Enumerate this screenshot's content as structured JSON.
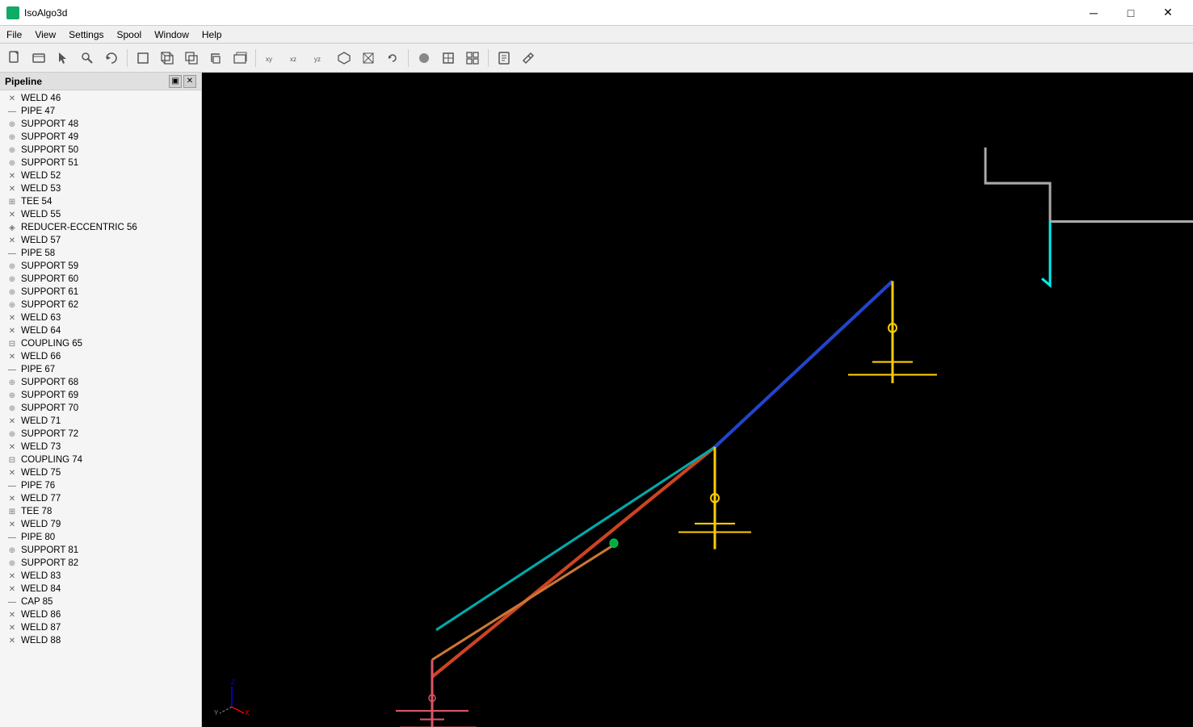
{
  "app": {
    "title": "IsoAlgo3d",
    "icon": "3d-app-icon"
  },
  "titlebar": {
    "minimize_label": "─",
    "maximize_label": "□",
    "close_label": "✕"
  },
  "menubar": {
    "items": [
      {
        "label": "File"
      },
      {
        "label": "View"
      },
      {
        "label": "Settings"
      },
      {
        "label": "Spool"
      },
      {
        "label": "Window"
      },
      {
        "label": "Help"
      }
    ]
  },
  "toolbar": {
    "buttons": [
      {
        "name": "new",
        "icon": "📄"
      },
      {
        "name": "open",
        "icon": "📂"
      },
      {
        "name": "pointer",
        "icon": "↖"
      },
      {
        "name": "search",
        "icon": "🔍"
      },
      {
        "name": "refresh",
        "icon": "↺"
      },
      {
        "name": "copy1",
        "icon": "⬜"
      },
      {
        "name": "copy2",
        "icon": "⬜"
      },
      {
        "name": "copy3",
        "icon": "⬜"
      },
      {
        "name": "copy4",
        "icon": "⬜"
      },
      {
        "name": "copy5",
        "icon": "⬜"
      },
      {
        "name": "box1",
        "icon": "⬛"
      },
      {
        "name": "view1",
        "icon": "◱"
      },
      {
        "name": "view2",
        "icon": "◳"
      },
      {
        "name": "view3",
        "icon": "◰"
      },
      {
        "name": "fit",
        "icon": "⊡"
      },
      {
        "name": "reset",
        "icon": "↩"
      },
      {
        "name": "sphere",
        "icon": "●"
      },
      {
        "name": "select",
        "icon": "▣"
      },
      {
        "name": "group",
        "icon": "⊞"
      },
      {
        "name": "sep1",
        "icon": ""
      },
      {
        "name": "book",
        "icon": "📖"
      },
      {
        "name": "tool2",
        "icon": "✈"
      }
    ]
  },
  "pipeline": {
    "title": "Pipeline",
    "items": [
      {
        "id": 46,
        "type": "WELD",
        "label": "WELD 46"
      },
      {
        "id": 47,
        "type": "PIPE",
        "label": "PIPE 47"
      },
      {
        "id": 48,
        "type": "SUPPORT",
        "label": "SUPPORT 48"
      },
      {
        "id": 49,
        "type": "SUPPORT",
        "label": "SUPPORT 49"
      },
      {
        "id": 50,
        "type": "SUPPORT",
        "label": "SUPPORT 50"
      },
      {
        "id": 51,
        "type": "SUPPORT",
        "label": "SUPPORT 51"
      },
      {
        "id": 52,
        "type": "WELD",
        "label": "WELD 52"
      },
      {
        "id": 53,
        "type": "WELD",
        "label": "WELD 53"
      },
      {
        "id": 54,
        "type": "TEE",
        "label": "TEE 54"
      },
      {
        "id": 55,
        "type": "WELD",
        "label": "WELD 55"
      },
      {
        "id": 56,
        "type": "REDUCER-ECCENTRIC",
        "label": "REDUCER-ECCENTRIC 56"
      },
      {
        "id": 57,
        "type": "WELD",
        "label": "WELD 57"
      },
      {
        "id": 58,
        "type": "PIPE",
        "label": "PIPE 58"
      },
      {
        "id": 59,
        "type": "SUPPORT",
        "label": "SUPPORT 59"
      },
      {
        "id": 60,
        "type": "SUPPORT",
        "label": "SUPPORT 60"
      },
      {
        "id": 61,
        "type": "SUPPORT",
        "label": "SUPPORT 61"
      },
      {
        "id": 62,
        "type": "SUPPORT",
        "label": "SUPPORT 62"
      },
      {
        "id": 63,
        "type": "WELD",
        "label": "WELD 63"
      },
      {
        "id": 64,
        "type": "WELD",
        "label": "WELD 64"
      },
      {
        "id": 65,
        "type": "COUPLING",
        "label": "COUPLING 65"
      },
      {
        "id": 66,
        "type": "WELD",
        "label": "WELD 66"
      },
      {
        "id": 67,
        "type": "PIPE",
        "label": "PIPE 67"
      },
      {
        "id": 68,
        "type": "SUPPORT",
        "label": "SUPPORT 68"
      },
      {
        "id": 69,
        "type": "SUPPORT",
        "label": "SUPPORT 69"
      },
      {
        "id": 70,
        "type": "SUPPORT",
        "label": "SUPPORT 70"
      },
      {
        "id": 71,
        "type": "WELD",
        "label": "WELD 71"
      },
      {
        "id": 72,
        "type": "SUPPORT",
        "label": "SUPPORT 72"
      },
      {
        "id": 73,
        "type": "WELD",
        "label": "WELD 73"
      },
      {
        "id": 74,
        "type": "COUPLING",
        "label": "COUPLING 74"
      },
      {
        "id": 75,
        "type": "WELD",
        "label": "WELD 75"
      },
      {
        "id": 76,
        "type": "PIPE",
        "label": "PIPE 76"
      },
      {
        "id": 77,
        "type": "WELD",
        "label": "WELD 77"
      },
      {
        "id": 78,
        "type": "TEE",
        "label": "TEE 78"
      },
      {
        "id": 79,
        "type": "WELD",
        "label": "WELD 79"
      },
      {
        "id": 80,
        "type": "PIPE",
        "label": "PIPE 80"
      },
      {
        "id": 81,
        "type": "SUPPORT",
        "label": "SUPPORT 81"
      },
      {
        "id": 82,
        "type": "SUPPORT",
        "label": "SUPPORT 82"
      },
      {
        "id": 83,
        "type": "WELD",
        "label": "WELD 83"
      },
      {
        "id": 84,
        "type": "WELD",
        "label": "WELD 84"
      },
      {
        "id": 85,
        "type": "CAP",
        "label": "CAP 85"
      },
      {
        "id": 86,
        "type": "WELD",
        "label": "WELD 86"
      },
      {
        "id": 87,
        "type": "WELD",
        "label": "WELD 87"
      },
      {
        "id": 88,
        "type": "WELD",
        "label": "WELD 88"
      }
    ]
  },
  "viewport": {
    "axis_x": "X",
    "axis_y": "Y",
    "axis_z": "Z",
    "bg_color": "#000000"
  },
  "colors": {
    "pipeline_red": "#cc3333",
    "pipeline_orange": "#ff8844",
    "pipeline_cyan": "#00cccc",
    "pipeline_blue": "#2244cc",
    "pipeline_gray": "#aaaaaa",
    "pipeline_yellow": "#ffcc00",
    "accent": "#1a6"
  }
}
